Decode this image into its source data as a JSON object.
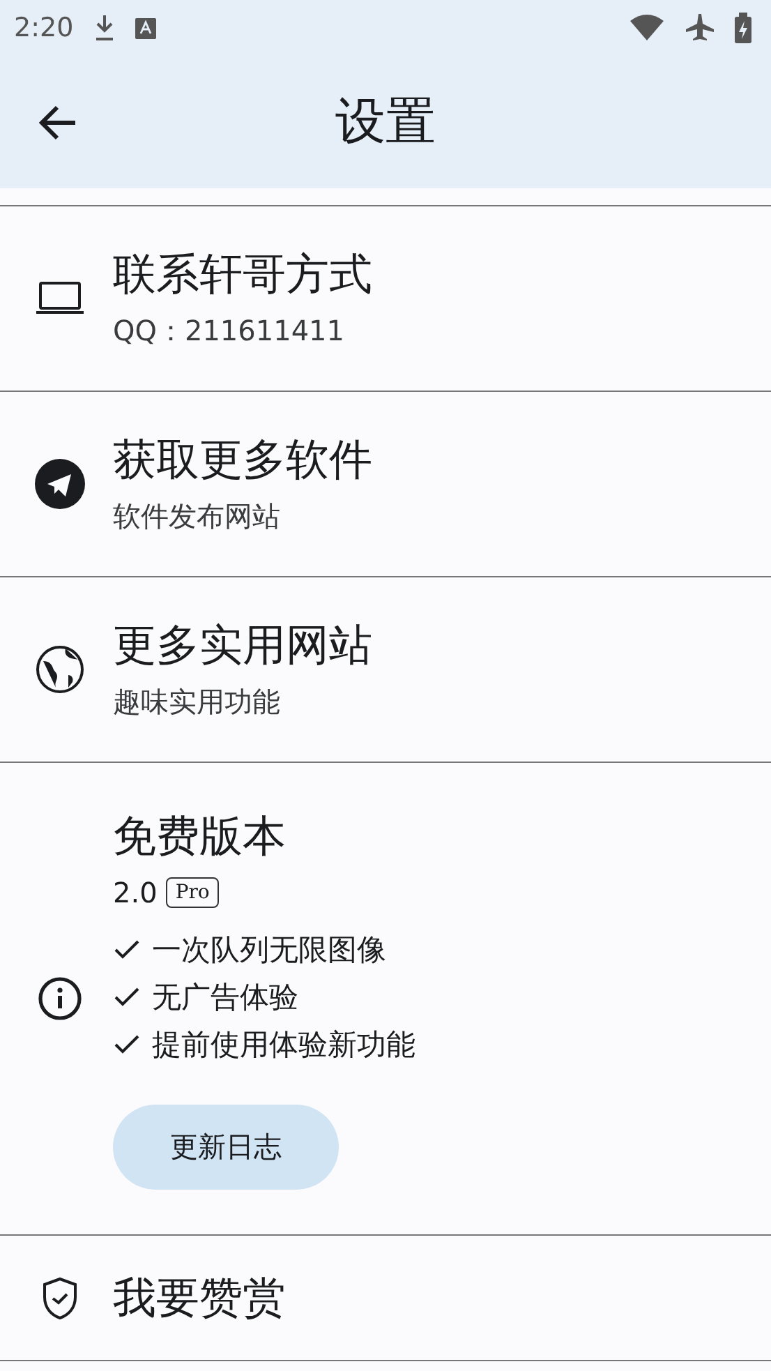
{
  "status_bar": {
    "time": "2:20"
  },
  "app_bar": {
    "title": "设置"
  },
  "items": [
    {
      "kind": "simple",
      "title": "联系轩哥方式",
      "subtitle": "QQ：211611411"
    },
    {
      "kind": "simple",
      "title": "获取更多软件",
      "subtitle": "软件发布网站"
    },
    {
      "kind": "simple",
      "title": "更多实用网站",
      "subtitle": "趣味实用功能"
    },
    {
      "kind": "version",
      "title": "免费版本",
      "version": "2.0",
      "badge": "Pro",
      "features": [
        "一次队列无限图像",
        "无广告体验",
        "提前使用体验新功能"
      ],
      "button": "更新日志"
    },
    {
      "kind": "simple",
      "title": "我要赞赏"
    }
  ]
}
